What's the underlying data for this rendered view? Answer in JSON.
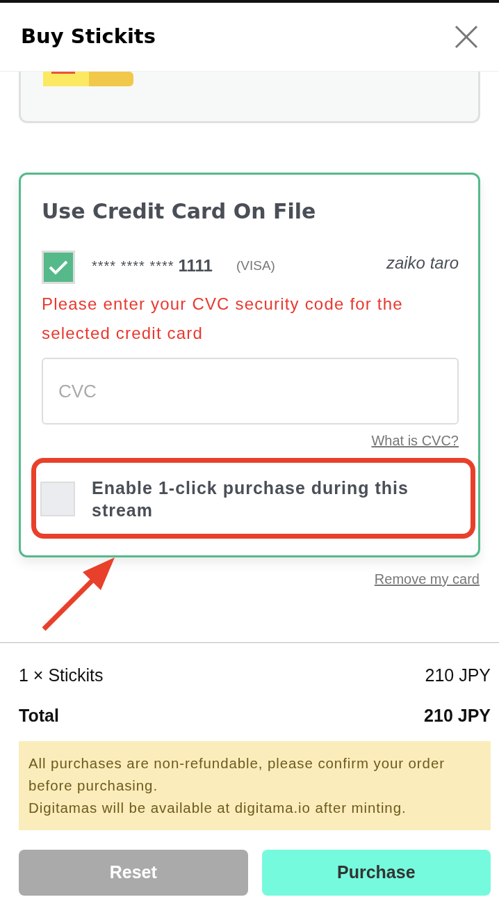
{
  "header": {
    "title": "Buy Stickits"
  },
  "card_on_file": {
    "title": "Use Credit Card On File",
    "card": {
      "selected": true,
      "masked": "**** **** ****",
      "last4": "1111",
      "brand": "(VISA)",
      "holder": "zaiko taro"
    },
    "error": "Please enter your CVC security code for the selected credit card",
    "cvc": {
      "placeholder": "CVC"
    },
    "help_link": "What is CVC?",
    "one_click": {
      "label": "Enable 1-click purchase during this stream",
      "checked": false,
      "highlighted": true
    }
  },
  "remove_link": "Remove my card",
  "summary": [
    {
      "kind": "line",
      "label": "1 × Stickits",
      "amount": "210 JPY"
    },
    {
      "kind": "total",
      "label": "Total",
      "amount": "210 JPY"
    }
  ],
  "notice": [
    "All purchases are non-refundable, please confirm your order before purchasing.",
    "Digitamas will be available at digitama.io after minting."
  ],
  "buttons": [
    {
      "kind": "secondary",
      "label": "Reset"
    },
    {
      "kind": "primary",
      "label": "Purchase"
    }
  ]
}
